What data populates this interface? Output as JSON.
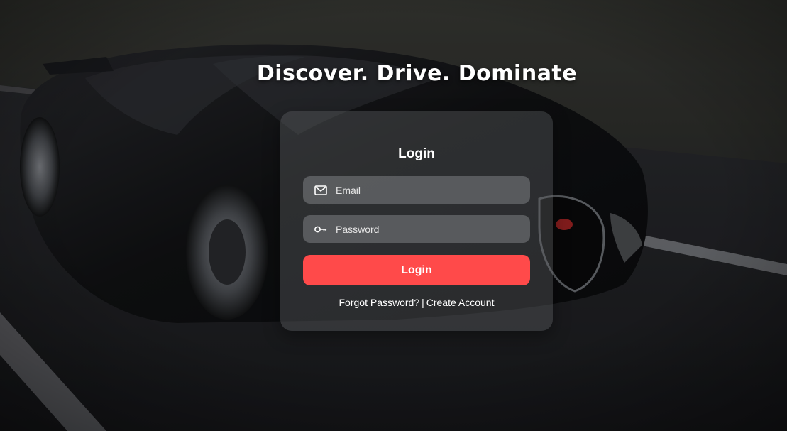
{
  "hero": {
    "tagline": "Discover. Drive. Dominate"
  },
  "login_card": {
    "title": "Login",
    "email_placeholder": "Email",
    "password_placeholder": "Password",
    "submit_label": "Login",
    "forgot_password_label": "Forgot Password?",
    "separator": "|",
    "create_account_label": "Create Account"
  },
  "icons": {
    "email": "mail-icon",
    "password": "key-icon"
  },
  "colors": {
    "accent": "#ff4a4a",
    "text": "#ffffff"
  }
}
